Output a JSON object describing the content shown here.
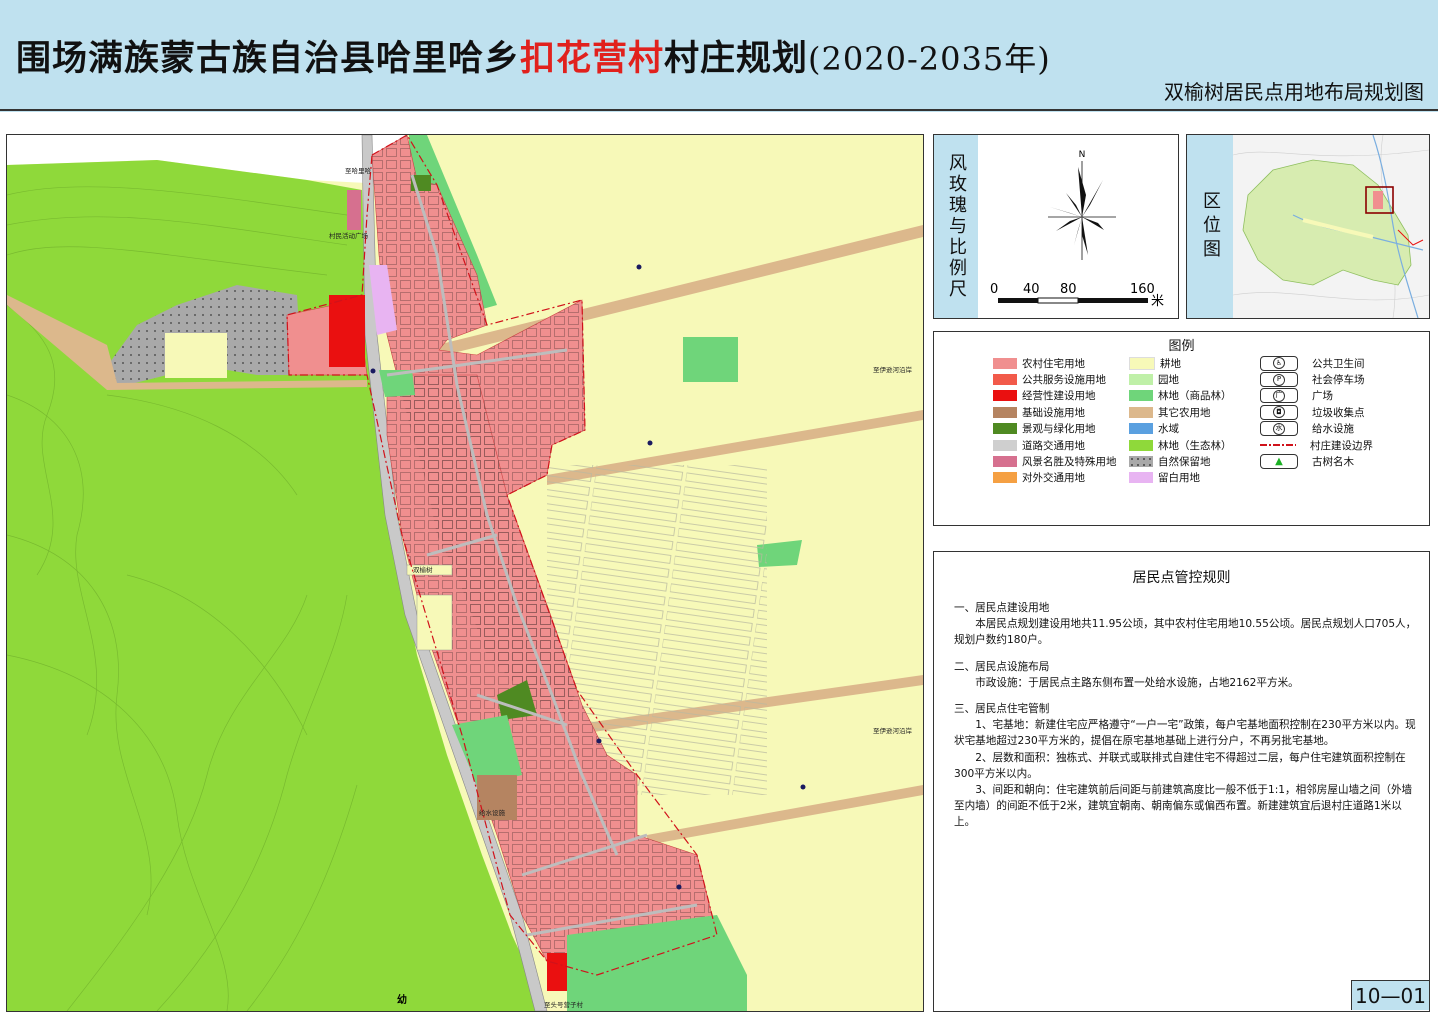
{
  "header": {
    "title_prefix": "围场满族蒙古族自治县哈里哈乡",
    "title_highlight": "扣花营村",
    "title_suffix": "村庄规划",
    "title_years": "(2020-2035年)",
    "subtitle": "双榆树居民点用地布局规划图"
  },
  "map": {
    "labels": {
      "north_road": "至哈里哈",
      "square": "村民活动广场",
      "road_east_1": "至伊逊河沿岸",
      "road_east_2": "至伊逊河沿岸",
      "village": "双榆树",
      "water_facility": "给水设施",
      "road_south": "至头号营子村",
      "tree_mark": "幼"
    },
    "colors": {
      "farmland": "#f7f9b8",
      "eco_forest": "#8fd93a",
      "residential": "#f08f8f",
      "commercial": "#ea1010",
      "road": "#c9c9c9",
      "forest_commodity": "#6fd57a",
      "garden": "#bff0a8",
      "landscape": "#4f8a22",
      "other_agri": "#dcb88c",
      "reserve": "#a9a9a9",
      "vacant": "#e8b4f2",
      "infrastructure": "#b58461"
    }
  },
  "rose_panel": {
    "label": "风玫瑰与比例尺",
    "north": "N",
    "scale_ticks": [
      "0",
      "40",
      "80",
      "160"
    ],
    "scale_unit": "米"
  },
  "location_panel": {
    "label": "区位图"
  },
  "legend": {
    "title": "图例",
    "land_uses": [
      {
        "label": "农村住宅用地",
        "color": "#f08f8f"
      },
      {
        "label": "公共服务设施用地",
        "color": "#f25a4a"
      },
      {
        "label": "经营性建设用地",
        "color": "#ea1010"
      },
      {
        "label": "基础设施用地",
        "color": "#b58461"
      },
      {
        "label": "景观与绿化用地",
        "color": "#4f8a22"
      },
      {
        "label": "道路交通用地",
        "color": "#cfcfcf"
      },
      {
        "label": "风景名胜及特殊用地",
        "color": "#d6708f"
      },
      {
        "label": "对外交通用地",
        "color": "#f5a043"
      }
    ],
    "land_uses_2": [
      {
        "label": "耕地",
        "color": "#f7f9b8"
      },
      {
        "label": "园地",
        "color": "#bff0a8"
      },
      {
        "label": "林地（商品林）",
        "color": "#6fd57a"
      },
      {
        "label": "其它农用地",
        "color": "#dcb88c"
      },
      {
        "label": "水域",
        "color": "#5aa0e0"
      },
      {
        "label": "林地（生态林）",
        "color": "#8fd93a"
      },
      {
        "label": "自然保留地",
        "color": "#a9a9a9"
      },
      {
        "label": "留白用地",
        "color": "#e8b4f2"
      }
    ],
    "symbols": [
      {
        "label": "公共卫生间",
        "icon": "toilet-icon",
        "glyph": "♿"
      },
      {
        "label": "社会停车场",
        "icon": "parking-icon",
        "glyph": "P"
      },
      {
        "label": "广场",
        "icon": "square-icon",
        "glyph": "广"
      },
      {
        "label": "垃圾收集点",
        "icon": "trash-icon",
        "glyph": "◘"
      },
      {
        "label": "给水设施",
        "icon": "water-supply-icon",
        "glyph": "水"
      },
      {
        "label": "村庄建设边界",
        "icon": "boundary-line-icon",
        "glyph": ""
      },
      {
        "label": "古树名木",
        "icon": "ancient-tree-icon",
        "glyph": "▲"
      }
    ]
  },
  "rules": {
    "title": "居民点管控规则",
    "s1_title": "一、居民点建设用地",
    "s1_p1": "本居民点规划建设用地共11.95公顷，其中农村住宅用地10.55公顷。居民点规划人口705人，规划户数约180户。",
    "s2_title": "二、居民点设施布局",
    "s2_p1": "市政设施：于居民点主路东侧布置一处给水设施，占地2162平方米。",
    "s3_title": "三、居民点住宅管制",
    "s3_p1": "1、宅基地：新建住宅应严格遵守“一户一宅”政策，每户宅基地面积控制在230平方米以内。现状宅基地超过230平方米的，提倡在原宅基地基础上进行分户，不再另批宅基地。",
    "s3_p2": "2、层数和面积：独栋式、并联式或联排式自建住宅不得超过二层，每户住宅建筑面积控制在300平方米以内。",
    "s3_p3": "3、间距和朝向：住宅建筑前后间距与前建筑高度比一般不低于1:1，相邻房屋山墙之间（外墙至内墙）的间距不低于2米，建筑宜朝南、朝南偏东或偏西布置。新建建筑宜后退村庄道路1米以上。"
  },
  "page_number": "10—01"
}
